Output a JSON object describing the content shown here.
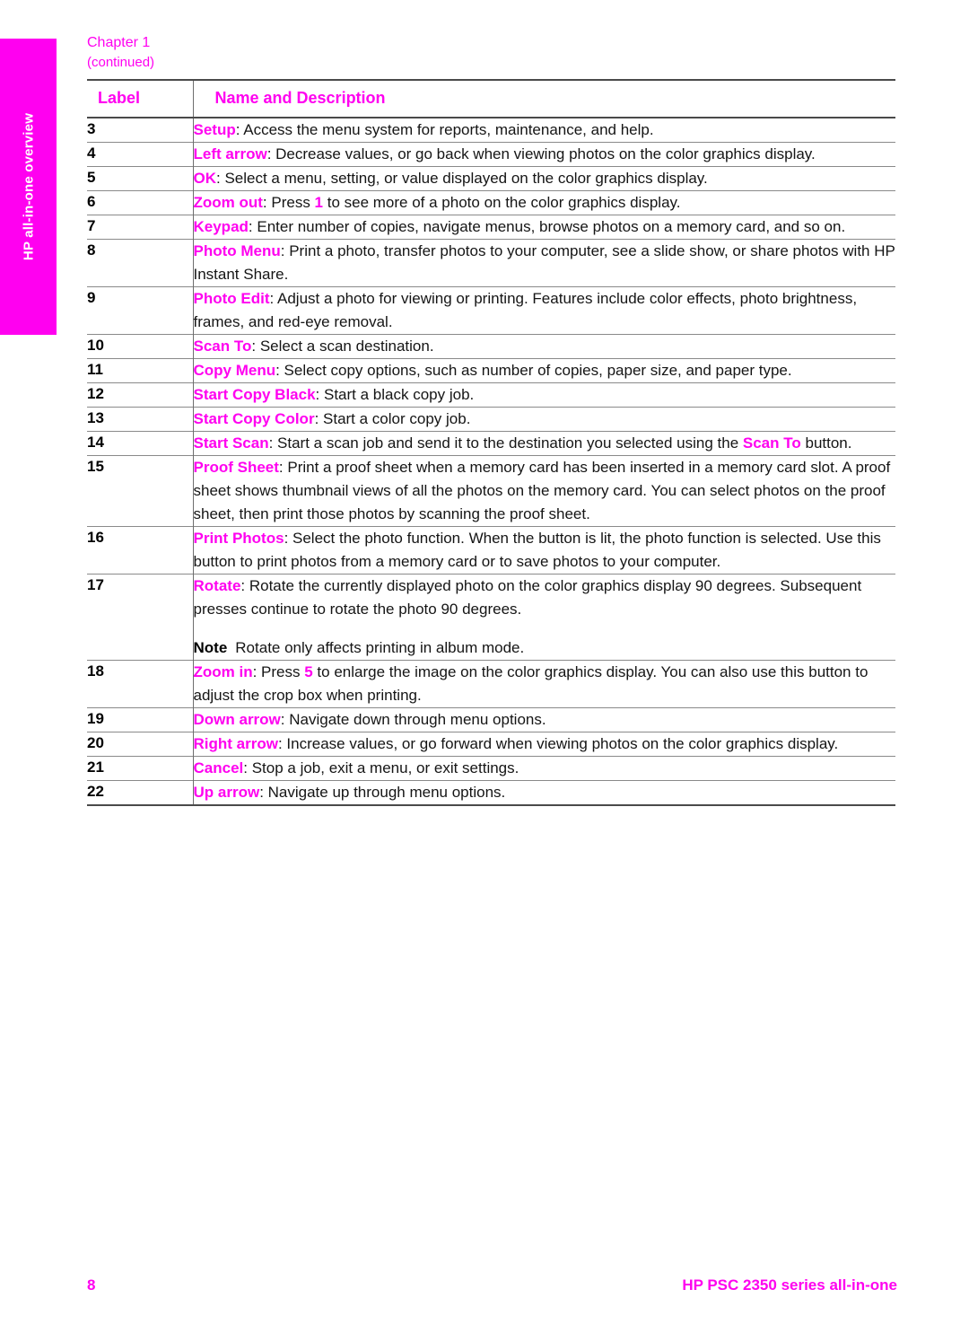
{
  "side_tab": {
    "label": "HP all-in-one overview",
    "background_color": "#ff00f0",
    "text_color": "#ffffff"
  },
  "header": {
    "chapter": "Chapter 1",
    "continued": "(continued)"
  },
  "accent_color": "#ff00f0",
  "table": {
    "columns": {
      "label": "Label",
      "description": "Name and Description"
    },
    "rows": [
      {
        "label": "3",
        "term": "Setup",
        "text": ": Access the menu system for reports, maintenance, and help."
      },
      {
        "label": "4",
        "term": "Left arrow",
        "text": ": Decrease values, or go back when viewing photos on the color graphics display."
      },
      {
        "label": "5",
        "term": "OK",
        "text": ": Select a menu, setting, or value displayed on the color graphics display."
      },
      {
        "label": "6",
        "term": "Zoom out",
        "text_before": ": Press ",
        "keynum": "1",
        "text_after": " to see more of a photo on the color graphics display."
      },
      {
        "label": "7",
        "term": "Keypad",
        "text": ": Enter number of copies, navigate menus, browse photos on a memory card, and so on."
      },
      {
        "label": "8",
        "term": "Photo Menu",
        "text": ": Print a photo, transfer photos to your computer, see a slide show, or share photos with HP Instant Share."
      },
      {
        "label": "9",
        "term": "Photo Edit",
        "text": ": Adjust a photo for viewing or printing. Features include color effects, photo brightness, frames, and red-eye removal."
      },
      {
        "label": "10",
        "term": "Scan To",
        "text": ": Select a scan destination."
      },
      {
        "label": "11",
        "term": "Copy Menu",
        "text": ": Select copy options, such as number of copies, paper size, and paper type."
      },
      {
        "label": "12",
        "term": "Start Copy Black",
        "text": ": Start a black copy job."
      },
      {
        "label": "13",
        "term": "Start Copy Color",
        "text": ": Start a color copy job."
      },
      {
        "label": "14",
        "term": "Start Scan",
        "text_before": ": Start a scan job and send it to the destination you selected using the ",
        "term2": "Scan To",
        "text_after": " button."
      },
      {
        "label": "15",
        "term": "Proof Sheet",
        "text": ": Print a proof sheet when a memory card has been inserted in a memory card slot. A proof sheet shows thumbnail views of all the photos on the memory card. You can select photos on the proof sheet, then print those photos by scanning the proof sheet."
      },
      {
        "label": "16",
        "term": "Print Photos",
        "text": ": Select the photo function. When the button is lit, the photo function is selected. Use this button to print photos from a memory card or to save photos to your computer."
      },
      {
        "label": "17",
        "term": "Rotate",
        "text": ": Rotate the currently displayed photo on the color graphics display 90 degrees. Subsequent presses continue to rotate the photo 90 degrees.",
        "note_label": "Note",
        "note_text": "Rotate only affects printing in album mode."
      },
      {
        "label": "18",
        "term": "Zoom in",
        "text_before": ": Press ",
        "keynum": "5",
        "text_after": " to enlarge the image on the color graphics display. You can also use this button to adjust the crop box when printing."
      },
      {
        "label": "19",
        "term": "Down arrow",
        "text": ": Navigate down through menu options."
      },
      {
        "label": "20",
        "term": "Right arrow",
        "text": ": Increase values, or go forward when viewing photos on the color graphics display."
      },
      {
        "label": "21",
        "term": "Cancel",
        "text": ": Stop a job, exit a menu, or exit settings."
      },
      {
        "label": "22",
        "term": "Up arrow",
        "text": ": Navigate up through menu options."
      }
    ]
  },
  "footer": {
    "page_number": "8",
    "product_title": "HP PSC 2350 series all-in-one"
  }
}
